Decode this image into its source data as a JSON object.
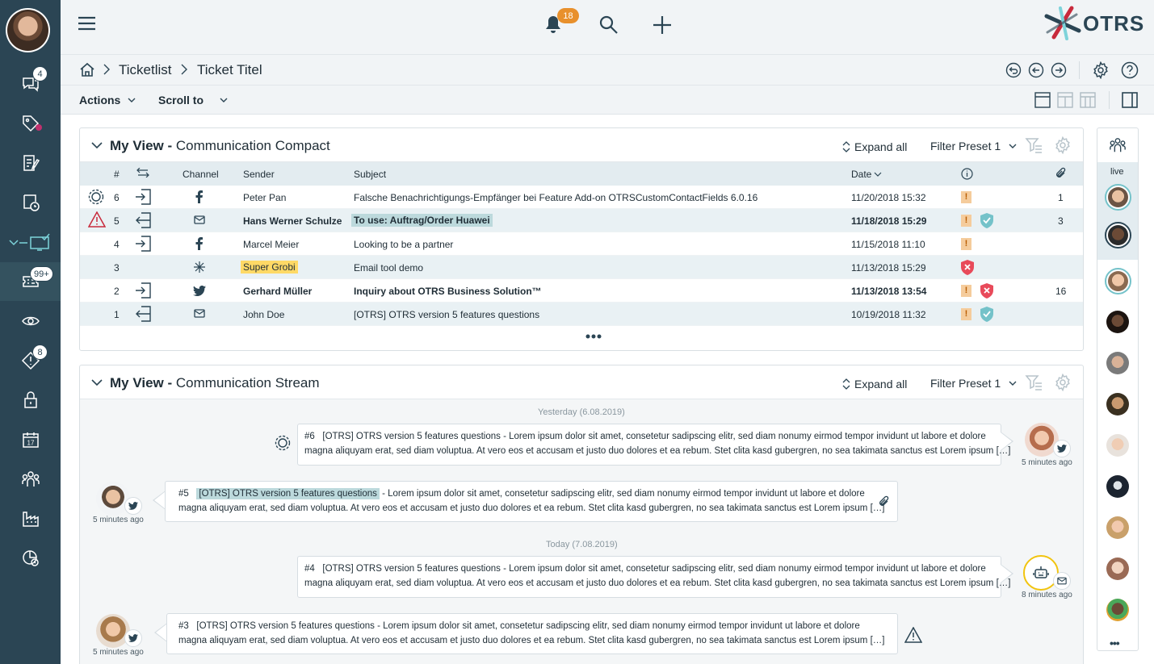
{
  "header": {
    "notification_count": "18",
    "logo_text": "OTRS",
    "brand_color": "#2b4554"
  },
  "sidebar": {
    "badges": {
      "chat": "4",
      "tickets": "99+",
      "alerts": "8"
    },
    "items": [
      "chat-icon",
      "tag-icon",
      "notes-icon",
      "clock-icon",
      "monitor-icon",
      "ticket-icon",
      "eye-icon",
      "alert-icon",
      "lock-icon",
      "calendar-icon",
      "team-icon",
      "factory-icon",
      "reports-icon"
    ]
  },
  "breadcrumb": {
    "items": [
      "Ticketlist",
      "Ticket Titel"
    ]
  },
  "toolbar": {
    "actions_label": "Actions",
    "scroll_label": "Scroll to"
  },
  "compact": {
    "title_prefix": "My View - ",
    "title": "Communication Compact",
    "expand_label": "Expand all",
    "filter_label": "Filter Preset 1",
    "columns": {
      "num": "#",
      "channel": "Channel",
      "sender": "Sender",
      "subject": "Subject",
      "date": "Date"
    },
    "rows": [
      {
        "num": "6",
        "sender": "Peter Pan",
        "subject": "Falsche Benachrichtigungs-Empfänger bei Feature Add-on OTRSCustomContactFields 6.0.16",
        "date": "11/20/2018 15:32",
        "attachments": "1"
      },
      {
        "num": "5",
        "sender": "Hans Werner Schulze",
        "subject": "To use: Auftrag/Order Huawei",
        "date": "11/18/2018 15:29",
        "attachments": "3"
      },
      {
        "num": "4",
        "sender": "Marcel Meier",
        "subject": "Looking to be a partner",
        "date": "11/15/2018 11:10",
        "attachments": ""
      },
      {
        "num": "3",
        "sender": "Super Grobi",
        "subject": "Email tool demo",
        "date": "11/13/2018 15:29",
        "attachments": ""
      },
      {
        "num": "2",
        "sender": "Gerhard Müller",
        "subject": "Inquiry about OTRS Business Solution™",
        "date": "11/13/2018 13:54",
        "attachments": "16"
      },
      {
        "num": "1",
        "sender": "John Doe",
        "subject": "[OTRS] OTRS version 5 features questions",
        "date": "10/19/2018 11:32",
        "attachments": ""
      }
    ],
    "exclamation": "!"
  },
  "stream": {
    "title_prefix": "My View - ",
    "title": "Communication Stream",
    "expand_label": "Expand all",
    "filter_label": "Filter Preset 1",
    "day1": "Yesterday (6.08.2019)",
    "day2": "Today (7.08.2019)",
    "messages": [
      {
        "num": "#6",
        "subject": "[OTRS] OTRS version 5 features questions",
        "body_line1": " - Lorem ipsum dolor sit amet, consetetur sadipscing elitr, sed diam nonumy eirmod tempor invidunt ut labore et dolore",
        "body_line2": "magna aliquyam erat, sed diam voluptua. At vero eos et accusam et justo duo dolores et ea rebum. Stet clita kasd gubergren, no sea takimata sanctus est Lorem ipsum […]",
        "time": "5 minutes ago"
      },
      {
        "num": "#5",
        "subject": "[OTRS] OTRS version 5 features questions",
        "body_line1": " - Lorem ipsum dolor sit amet, consetetur sadipscing elitr, sed diam nonumy eirmod tempor invidunt ut labore et dolore",
        "body_line2": "magna aliquyam erat, sed diam voluptua. At vero eos et accusam et justo duo dolores et ea rebum. Stet clita kasd gubergren, no sea takimata sanctus est Lorem ipsum […]",
        "time": "5 minutes ago"
      },
      {
        "num": "#4",
        "subject": "[OTRS] OTRS version 5 features questions",
        "body_line1": " - Lorem ipsum dolor sit amet, consetetur sadipscing elitr, sed diam nonumy eirmod tempor invidunt ut labore et dolore",
        "body_line2": "magna aliquyam erat, sed diam voluptua. At vero eos et accusam et justo duo dolores et ea rebum. Stet clita kasd gubergren, no sea takimata sanctus est Lorem ipsum […]",
        "time": "8 minutes ago"
      },
      {
        "num": "#3",
        "subject": "[OTRS] OTRS version 5 features questions",
        "body_line1": " - Lorem ipsum dolor sit amet, consetetur sadipscing elitr, sed diam nonumy eirmod tempor invidunt ut labore et dolore",
        "body_line2": "magna aliquyam erat, sed diam voluptua. At vero eos et accusam et justo duo dolores et ea rebum. Stet clita kasd gubergren, no sea takimata sanctus est Lorem ipsum […]",
        "time": "5 minutes ago"
      }
    ]
  },
  "live_panel": {
    "label": "live",
    "more": "•••"
  }
}
